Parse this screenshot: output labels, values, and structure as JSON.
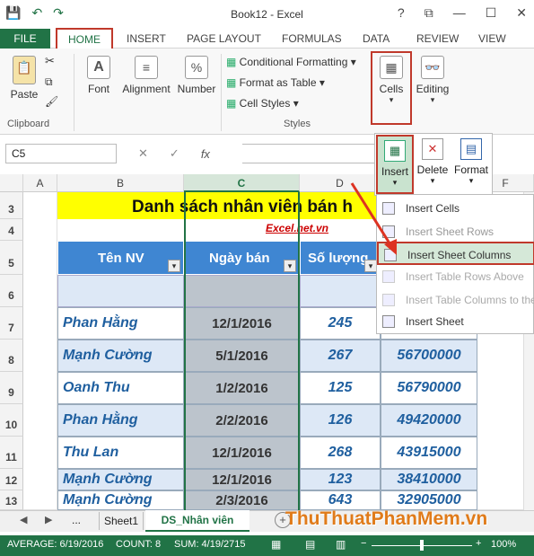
{
  "window": {
    "title": "Book12 - Excel",
    "help": "?",
    "restore": "⧉",
    "min": "—",
    "max": "☐",
    "close": "✕"
  },
  "qat": {
    "save": "💾",
    "undo": "↶",
    "redo": "↷"
  },
  "tabs": {
    "file": "FILE",
    "home": "HOME",
    "insert": "INSERT",
    "page_layout": "PAGE LAYOUT",
    "formulas": "FORMULAS",
    "data": "DATA",
    "review": "REVIEW",
    "view": "VIEW"
  },
  "ribbon": {
    "paste": "Paste",
    "clipboard": "Clipboard",
    "font": "Font",
    "alignment": "Alignment",
    "number": "Number",
    "percent": "%",
    "cond_format": "Conditional Formatting",
    "format_table": "Format as Table",
    "cell_styles": "Cell Styles",
    "styles": "Styles",
    "cells": "Cells",
    "editing": "Editing"
  },
  "formula_bar": {
    "name_box": "C5",
    "fx": "fx",
    "cancel": "✕",
    "enter": "✓"
  },
  "columns": [
    "A",
    "B",
    "C",
    "D",
    "E",
    "F"
  ],
  "rows": [
    "3",
    "4",
    "5",
    "6",
    "7",
    "8",
    "9",
    "10",
    "11",
    "12",
    "13"
  ],
  "sheet": {
    "title": "Danh sách nhân viên bán h",
    "link": "Excel.net.vn",
    "header_nv": "Tên NV",
    "header_ngay": "Ngày bán",
    "header_sl": "Số lượng"
  },
  "data_rows": [
    {
      "nv": "Phan Hằng",
      "ngay": "12/1/2016",
      "sl": "245",
      "tien": ""
    },
    {
      "nv": "Mạnh Cường",
      "ngay": "5/1/2016",
      "sl": "267",
      "tien": "56700000"
    },
    {
      "nv": "Oanh Thu",
      "ngay": "1/2/2016",
      "sl": "125",
      "tien": "56790000"
    },
    {
      "nv": "Phan Hằng",
      "ngay": "2/2/2016",
      "sl": "126",
      "tien": "49420000"
    },
    {
      "nv": "Thu Lan",
      "ngay": "12/1/2016",
      "sl": "268",
      "tien": "43915000"
    },
    {
      "nv": "Mạnh Cường",
      "ngay": "12/1/2016",
      "sl": "123",
      "tien": "38410000"
    },
    {
      "nv": "Mạnh Cường",
      "ngay": "2/3/2016",
      "sl": "643",
      "tien": "32905000"
    }
  ],
  "cells_dropdown": {
    "insert": "Insert",
    "delete": "Delete",
    "format": "Format"
  },
  "insert_menu": [
    "Insert Cells",
    "Insert Sheet Rows",
    "Insert Sheet Columns",
    "Insert Table Rows Above",
    "Insert Table Columns to the",
    "Insert Sheet"
  ],
  "sheet_tabs": {
    "ellipsis": "...",
    "sheet1": "Sheet1",
    "active": "DS_Nhân viên",
    "add": "+"
  },
  "status": {
    "average": "AVERAGE: 6/19/2016",
    "count": "COUNT: 8",
    "sum": "SUM: 4/19/2715",
    "zoom": "100%",
    "minus": "−",
    "plus": "+"
  },
  "watermark": "ThuThuatPhanMem.vn"
}
